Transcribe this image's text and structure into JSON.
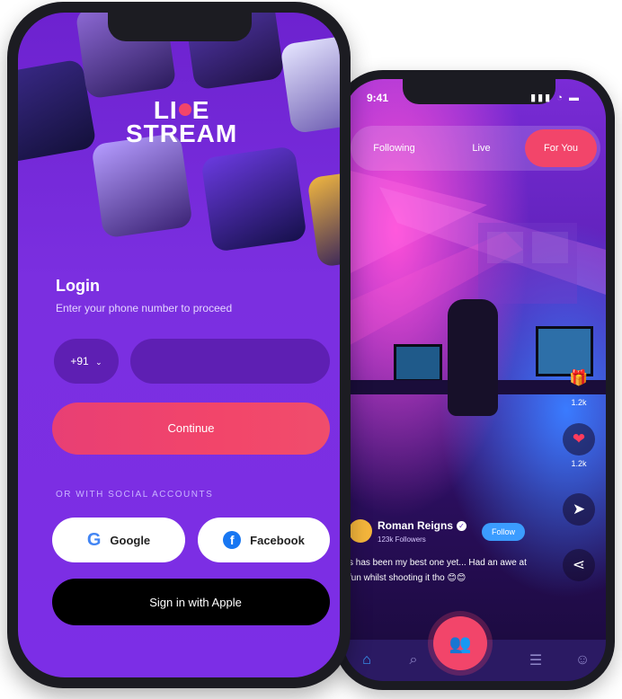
{
  "right_phone": {
    "status_time": "9:41",
    "tabs": [
      {
        "label": "Following"
      },
      {
        "label": "Live"
      },
      {
        "label": "For You"
      }
    ],
    "actions": [
      {
        "icon": "gift-icon",
        "count": "1.2k"
      },
      {
        "icon": "heart-icon",
        "count": "1.2k"
      }
    ],
    "streamer": {
      "name": "Roman Reigns",
      "followers": "123k Followers",
      "follow_label": "Follow",
      "caption": "s has been my best one yet... Had an awe at fun whilst shooting it tho 😊😊"
    },
    "nav": [
      "home-icon",
      "search-icon",
      "stack-icon",
      "profile-icon"
    ]
  },
  "left_phone": {
    "logo_top": "LIVE",
    "logo_bottom": "STREAM",
    "login": {
      "title": "Login",
      "subtitle": "Enter your phone number to proceed",
      "country_code": "+91",
      "phone_placeholder": "",
      "continue_label": "Continue",
      "social_heading": "OR WITH SOCIAL ACCOUNTS",
      "google_label": "Google",
      "facebook_label": "Facebook",
      "apple_label": "Sign in with Apple"
    }
  },
  "colors": {
    "primary_purple": "#7b2fe0",
    "accent_pink": "#f2456a",
    "follow_blue": "#3b9cff"
  }
}
